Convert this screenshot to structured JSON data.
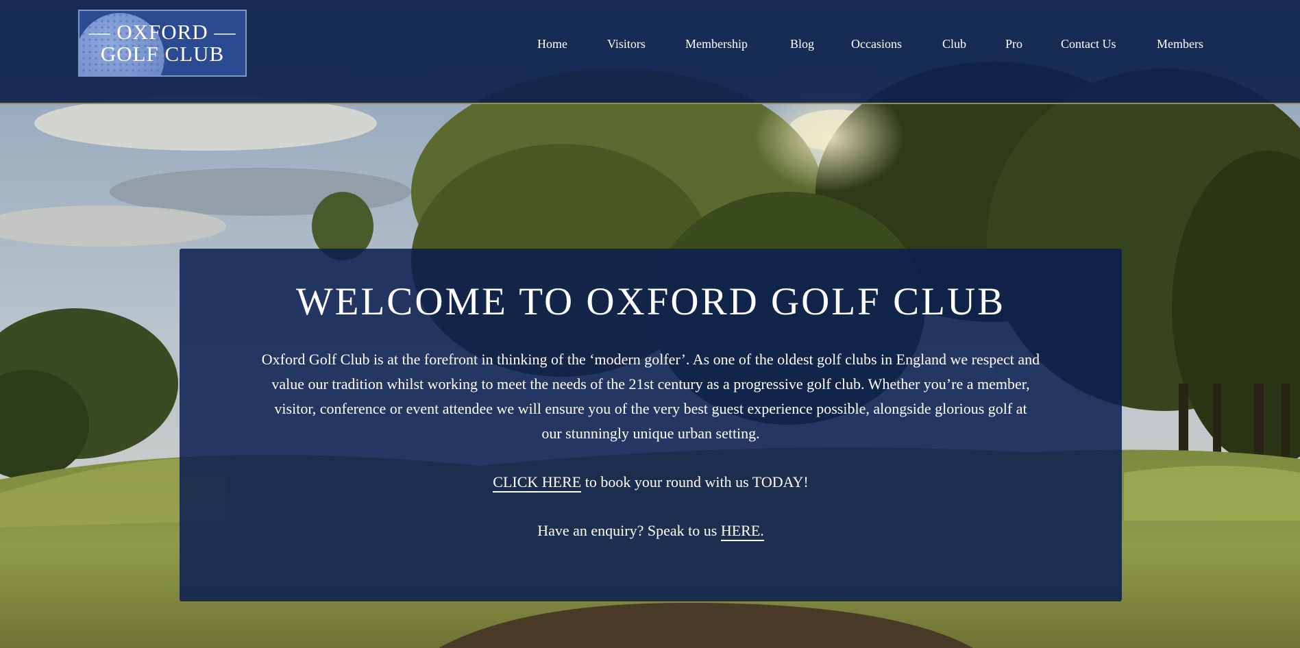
{
  "logo": {
    "line1": "— OXFORD —",
    "line2": "GOLF CLUB"
  },
  "nav": {
    "items": [
      {
        "label": "Home"
      },
      {
        "label": "Visitors"
      },
      {
        "label": "Membership"
      },
      {
        "label": "Blog"
      },
      {
        "label": "Occasions"
      },
      {
        "label": "Club"
      },
      {
        "label": "Pro"
      },
      {
        "label": "Contact Us"
      },
      {
        "label": "Members"
      }
    ]
  },
  "welcome": {
    "title": "WELCOME TO OXFORD GOLF CLUB",
    "body_lines": [
      "Oxford Golf Club is at the forefront in thinking of the ‘modern golfer’. As one of the oldest golf clubs in England we respect and",
      "value our tradition whilst working to meet the needs of the 21st century as a progressive golf club. Whether you’re a member,",
      "visitor, conference or event attendee we will ensure you of the very best guest experience possible, alongside glorious golf at",
      "our stunningly unique urban setting."
    ],
    "cta_link": "CLICK HERE",
    "cta_rest": " to book your round with us TODAY!",
    "enquiry_text": "Have an enquiry? Speak to us ",
    "enquiry_link": "HERE."
  },
  "colors": {
    "header_bg": "#0e224e",
    "panel_bg": "#0a1e50",
    "divider": "#9a8a5e",
    "text": "#ffffff"
  }
}
